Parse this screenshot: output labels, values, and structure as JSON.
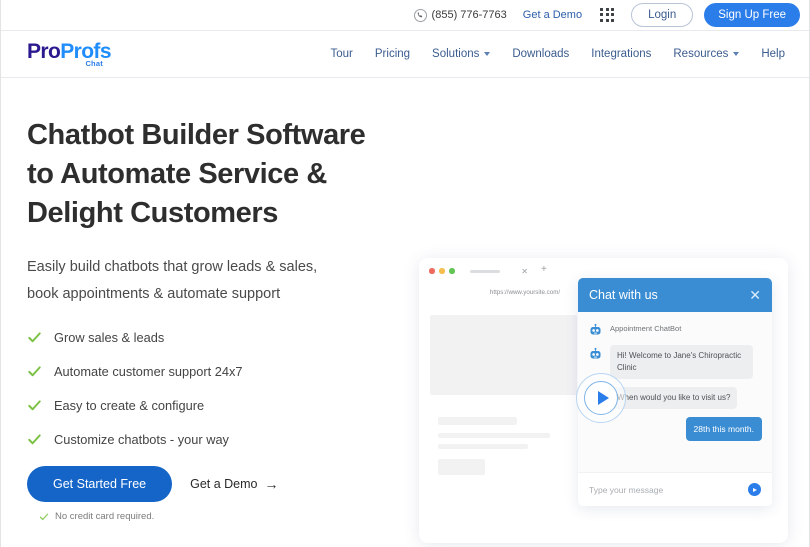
{
  "topbar": {
    "phone": "(855) 776-7763",
    "get_demo": "Get a Demo",
    "login": "Login",
    "signup": "Sign Up Free",
    "phone_icon": "phone-icon",
    "apps_icon": "grid-apps-icon"
  },
  "brand": {
    "name_part1": "Pro",
    "name_part2": "Profs",
    "product": "Chat",
    "color_dark": "#2b1a8f",
    "color_light": "#1f8dfb"
  },
  "nav": {
    "items": [
      {
        "label": "Tour",
        "has_caret": false
      },
      {
        "label": "Pricing",
        "has_caret": false
      },
      {
        "label": "Solutions",
        "has_caret": true
      },
      {
        "label": "Downloads",
        "has_caret": false
      },
      {
        "label": "Integrations",
        "has_caret": false
      },
      {
        "label": "Resources",
        "has_caret": true
      },
      {
        "label": "Help",
        "has_caret": false
      }
    ]
  },
  "hero": {
    "headline_line1": "Chatbot Builder Software",
    "headline_line2": "to Automate Service &",
    "headline_line3": "Delight Customers",
    "subhead_line1": "Easily build chatbots that grow leads & sales,",
    "subhead_line2": "book appointments & automate support",
    "features": [
      "Grow sales & leads",
      "Automate customer support 24x7",
      "Easy to create & configure",
      "Customize chatbots - your way"
    ],
    "cta_primary": "Get Started Free",
    "cta_secondary": "Get a Demo",
    "cta_arrow": "→",
    "no_credit_card": "No credit card required.",
    "check_color": "#7ac143",
    "primary_button_color": "#1565c9"
  },
  "mockup": {
    "url": "https://www.yoursite.com/",
    "tab_close": "✕",
    "tab_new": "+",
    "play_icon": "play-button-icon"
  },
  "chat": {
    "header_title": "Chat with us",
    "close_icon": "✕",
    "bot_label": "Appointment ChatBot",
    "messages": [
      {
        "from": "bot",
        "text": "Hi! Welcome to Jane's Chiropractic Clinic"
      },
      {
        "from": "bot",
        "text": "When would you like to visit us?"
      },
      {
        "from": "user",
        "text": "28th this month."
      }
    ],
    "input_placeholder": "Type your message",
    "send_icon": "send-icon",
    "accent_color": "#3a8dd3"
  }
}
